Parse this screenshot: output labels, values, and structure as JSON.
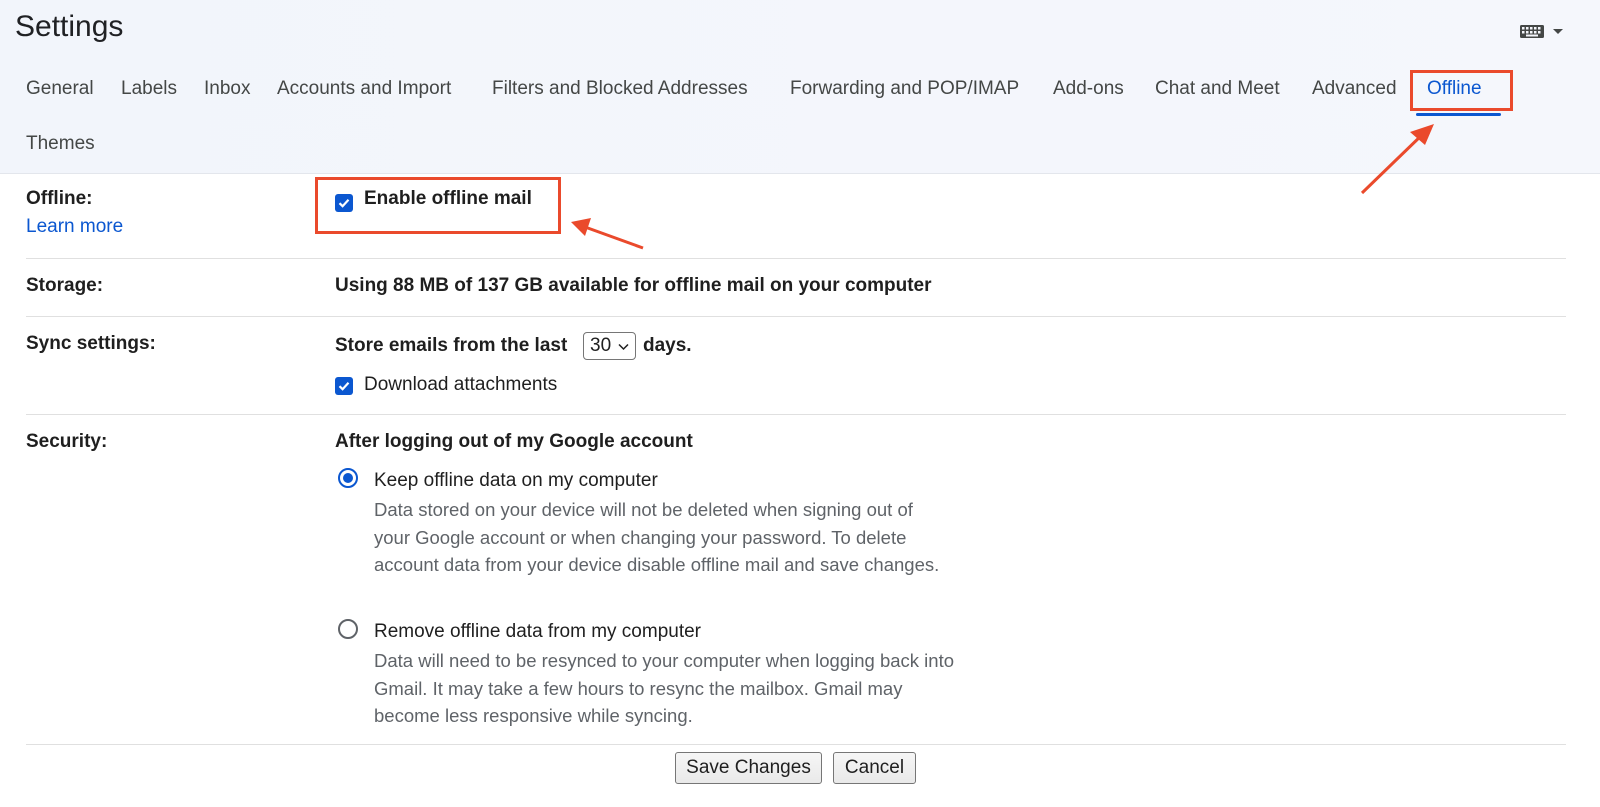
{
  "header": {
    "title": "Settings",
    "keyboard_icon": "keyboard-icon"
  },
  "tabs": [
    {
      "label": "General"
    },
    {
      "label": "Labels"
    },
    {
      "label": "Inbox"
    },
    {
      "label": "Accounts and Import"
    },
    {
      "label": "Filters and Blocked Addresses"
    },
    {
      "label": "Forwarding and POP/IMAP"
    },
    {
      "label": "Add-ons"
    },
    {
      "label": "Chat and Meet"
    },
    {
      "label": "Advanced"
    },
    {
      "label": "Offline",
      "active": true
    },
    {
      "label": "Themes"
    }
  ],
  "offline": {
    "label": "Offline:",
    "learn_more": "Learn more",
    "enable_label": "Enable offline mail",
    "enable_checked": true
  },
  "storage": {
    "label": "Storage:",
    "text": "Using 88 MB of 137 GB available for offline mail on your computer"
  },
  "sync": {
    "label": "Sync settings:",
    "prefix": "Store emails from the last",
    "days_value": "30",
    "suffix": "days.",
    "attachments_label": "Download attachments",
    "attachments_checked": true
  },
  "security": {
    "label": "Security:",
    "heading": "After logging out of my Google account",
    "keep_label": "Keep offline data on my computer",
    "keep_desc": "Data stored on your device will not be deleted when signing out of your Google account or when changing your password. To delete account data from your device disable offline mail and save changes.",
    "keep_selected": true,
    "remove_label": "Remove offline data from my computer",
    "remove_desc": "Data will need to be resynced to your computer when logging back into Gmail. It may take a few hours to resync the mailbox. Gmail may become less responsive while syncing."
  },
  "buttons": {
    "save": "Save Changes",
    "cancel": "Cancel"
  },
  "colors": {
    "accent": "#0b57d0",
    "highlight": "#ea4a2c"
  }
}
